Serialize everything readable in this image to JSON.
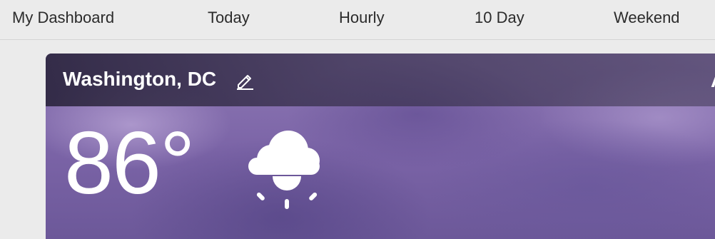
{
  "nav": {
    "items": [
      {
        "label": "My Dashboard"
      },
      {
        "label": "Today"
      },
      {
        "label": "Hourly"
      },
      {
        "label": "10 Day"
      },
      {
        "label": "Weekend"
      }
    ]
  },
  "card": {
    "location": "Washington, DC",
    "temperature": "86°",
    "condition_icon": "cloud-sun-icon",
    "edit_icon": "pencil-edit-icon",
    "overflow_glyph": "A"
  },
  "colors": {
    "nav_background": "#ebebeb",
    "nav_text": "#2b2b2b",
    "card_text": "#ffffff",
    "card_sky": "#7a63a6"
  }
}
